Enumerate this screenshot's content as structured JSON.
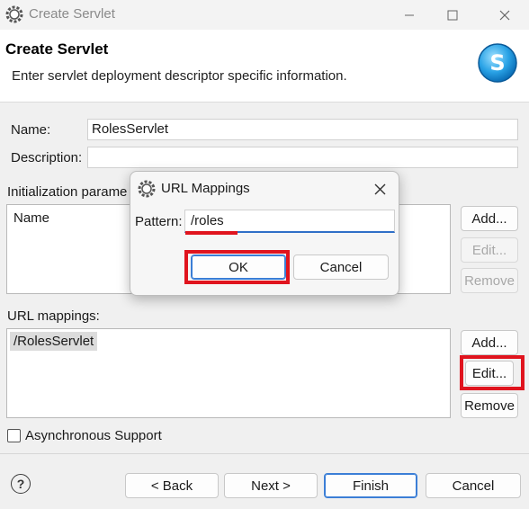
{
  "window": {
    "title": "Create Servlet"
  },
  "header": {
    "title": "Create Servlet",
    "description": "Enter servlet deployment descriptor specific information."
  },
  "form": {
    "name_label": "Name:",
    "name_value": "RolesServlet",
    "description_label": "Description:",
    "description_value": "",
    "init_params_label": "Initialization parame",
    "init_params_column": "Name",
    "url_mappings_label": "URL mappings:",
    "url_mappings_items": [
      "/RolesServlet"
    ],
    "async_label": "Asynchronous Support"
  },
  "side_buttons": {
    "init_add": "Add...",
    "init_edit": "Edit...",
    "init_remove": "Remove",
    "url_add": "Add...",
    "url_edit": "Edit...",
    "url_remove": "Remove"
  },
  "footer": {
    "back": "< Back",
    "next": "Next >",
    "finish": "Finish",
    "cancel": "Cancel",
    "help": "?"
  },
  "dialog": {
    "title": "URL Mappings",
    "pattern_label": "Pattern:",
    "pattern_value": "/roles",
    "ok": "OK",
    "cancel": "Cancel"
  },
  "icons": {
    "app": "eclipse-gear-icon",
    "banner": "servlet-s-icon",
    "close": "close-icon",
    "minimize": "minimize-icon",
    "maximize": "maximize-icon",
    "help": "help-icon"
  },
  "colors": {
    "highlight": "#e0141e",
    "accent": "#2f6fc7"
  }
}
